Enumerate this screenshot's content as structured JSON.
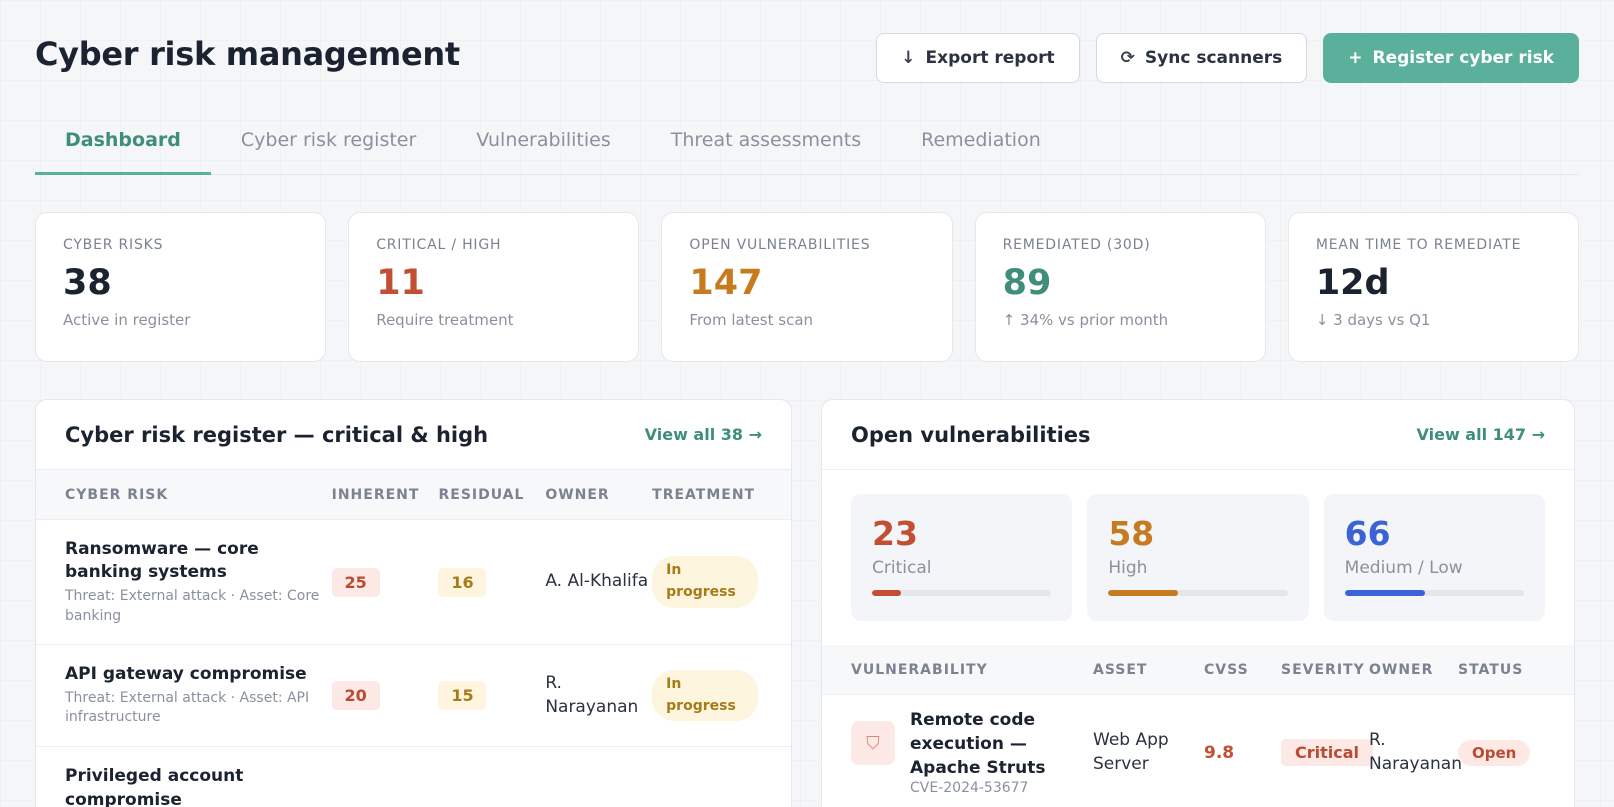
{
  "header": {
    "title": "Cyber risk management",
    "export_label": "Export report",
    "sync_label": "Sync scanners",
    "register_label": "Register cyber risk"
  },
  "tabs": [
    {
      "label": "Dashboard",
      "active": true
    },
    {
      "label": "Cyber risk register",
      "active": false
    },
    {
      "label": "Vulnerabilities",
      "active": false
    },
    {
      "label": "Threat assessments",
      "active": false
    },
    {
      "label": "Remediation",
      "active": false
    }
  ],
  "stats": [
    {
      "label": "Cyber risks",
      "value": "38",
      "sub": "Active in register",
      "color": "#1b2230"
    },
    {
      "label": "Critical / High",
      "value": "11",
      "sub": "Require treatment",
      "color": "#c24e34"
    },
    {
      "label": "Open vulnerabilities",
      "value": "147",
      "sub": "From latest scan",
      "color": "#c77b21"
    },
    {
      "label": "Remediated (30d)",
      "value": "89",
      "sub": "↑ 34% vs prior month",
      "color": "#3f8e7c"
    },
    {
      "label": "Mean time to remediate",
      "value": "12d",
      "sub": "↓ 3 days vs Q1",
      "color": "#1b2230"
    }
  ],
  "risk_panel": {
    "title": "Cyber risk register — critical & high",
    "link": "View all 38 →",
    "columns": [
      "Cyber risk",
      "Inherent",
      "Residual",
      "Owner",
      "Treatment"
    ],
    "rows": [
      {
        "name": "Ransomware — core banking systems",
        "desc": "Threat: External attack · Asset: Core banking",
        "inherent": "25",
        "residual": "16",
        "owner": "A. Al-Khalifa",
        "treatment": "In progress"
      },
      {
        "name": "API gateway compromise",
        "desc": "Threat: External attack · Asset: API infrastructure",
        "inherent": "20",
        "residual": "15",
        "owner": "R. Narayanan",
        "treatment": "In progress"
      },
      {
        "name": "Privileged account compromise",
        "desc": "",
        "inherent": "",
        "residual": "",
        "owner": "",
        "treatment": ""
      }
    ]
  },
  "vuln_panel": {
    "title": "Open vulnerabilities",
    "link": "View all 147 →",
    "severity": [
      {
        "count": "23",
        "label": "Critical",
        "fraction": 0.16,
        "color": "#c24e34"
      },
      {
        "count": "58",
        "label": "High",
        "fraction": 0.39,
        "color": "#c77b21"
      },
      {
        "count": "66",
        "label": "Medium / Low",
        "fraction": 0.45,
        "color": "#3c63d6"
      }
    ],
    "columns": [
      "Vulnerability",
      "Asset",
      "CVSS",
      "Severity",
      "Owner",
      "Status"
    ],
    "rows": [
      {
        "name": "Remote code execution — Apache Struts",
        "cve": "CVE-2024-53677",
        "asset": "Web App Server",
        "cvss": "9.8",
        "severity": "Critical",
        "owner": "R. Narayanan",
        "status": "Open"
      }
    ]
  }
}
